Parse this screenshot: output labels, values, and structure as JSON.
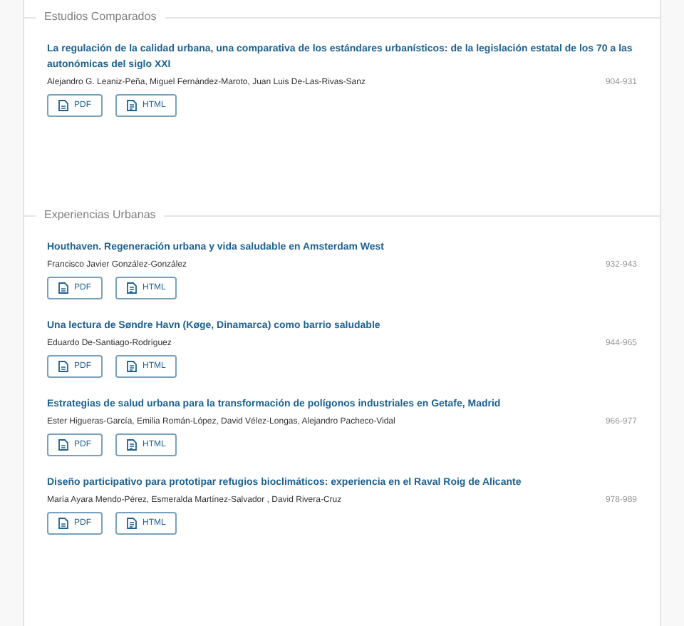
{
  "sections": [
    {
      "title": "Estudios Comparados",
      "articles": [
        {
          "title": "La regulación de la calidad urbana, una comparativa de los estándares urbanísticos: de la legislación estatal de los 70 a las autonómicas del siglo XXI",
          "authors": "Alejandro G. Leaniz-Peña, Miguel Fernández-Maroto, Juan Luis De-Las-Rivas-Sanz",
          "pages": "904-931",
          "galleys": [
            {
              "kind": "pdf",
              "label": "PDF"
            },
            {
              "kind": "html",
              "label": "HTML"
            }
          ]
        }
      ]
    },
    {
      "title": "Experiencias Urbanas",
      "articles": [
        {
          "title": "Houthaven. Regeneración urbana y vida saludable en Amsterdam West",
          "authors": "Francisco Javier González-González",
          "pages": "932-943",
          "galleys": [
            {
              "kind": "pdf",
              "label": "PDF"
            },
            {
              "kind": "html",
              "label": "HTML"
            }
          ]
        },
        {
          "title": "Una lectura de Søndre Havn (Køge, Dinamarca) como barrio saludable",
          "authors": "Eduardo De-Santiago-Rodríguez",
          "pages": "944-965",
          "galleys": [
            {
              "kind": "pdf",
              "label": "PDF"
            },
            {
              "kind": "html",
              "label": "HTML"
            }
          ]
        },
        {
          "title": "Estrategias de salud urbana para la transformación de polígonos industriales en Getafe, Madrid",
          "authors": "Ester Higueras-García, Emilia Román-López, David Vélez-Longas, Alejandro Pacheco-Vidal",
          "pages": "966-977",
          "galleys": [
            {
              "kind": "pdf",
              "label": "PDF"
            },
            {
              "kind": "html",
              "label": "HTML"
            }
          ]
        },
        {
          "title": "Diseño participativo para prototipar refugios bioclimáticos: experiencia en el Raval Roig de Alicante",
          "authors": "María Ayara Mendo-Pérez, Esmeralda Martínez-Salvador , David Rivera-Cruz",
          "pages": "978-989",
          "galleys": [
            {
              "kind": "pdf",
              "label": "PDF"
            },
            {
              "kind": "html",
              "label": "HTML"
            }
          ]
        }
      ]
    }
  ]
}
